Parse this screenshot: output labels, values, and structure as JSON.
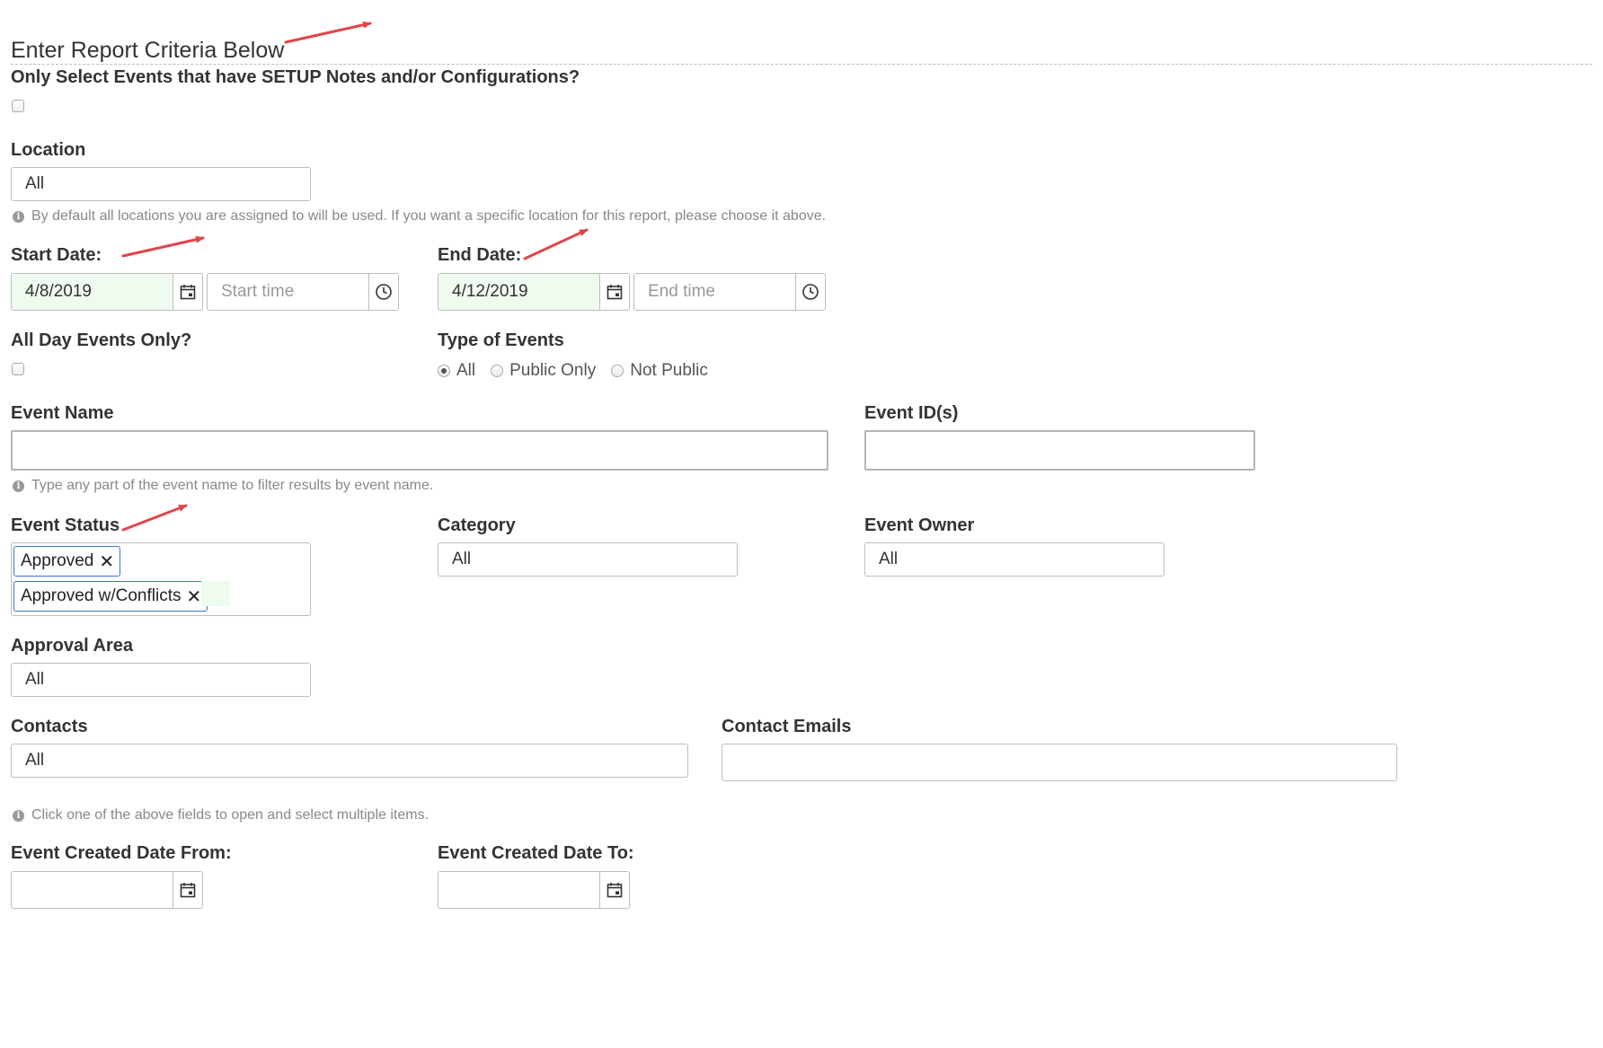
{
  "header": {
    "title": "Enter Report Criteria Below"
  },
  "setup_notes": {
    "label": "Only Select Events that have SETUP Notes and/or Configurations?",
    "checked": false
  },
  "location": {
    "label": "Location",
    "value": "All",
    "help": "By default all locations you are assigned to will be used. If you want a specific location for this report, please choose it above."
  },
  "start": {
    "label": "Start Date:",
    "date": "4/8/2019",
    "time_placeholder": "Start time"
  },
  "end": {
    "label": "End Date:",
    "date": "4/12/2019",
    "time_placeholder": "End time"
  },
  "all_day": {
    "label": "All Day Events Only?",
    "checked": false
  },
  "event_type": {
    "label": "Type of Events",
    "options": [
      {
        "label": "All",
        "selected": true
      },
      {
        "label": "Public Only",
        "selected": false
      },
      {
        "label": "Not Public",
        "selected": false
      }
    ]
  },
  "event_name": {
    "label": "Event Name",
    "value": "",
    "help": "Type any part of the event name to filter results by event name."
  },
  "event_ids": {
    "label": "Event ID(s)",
    "value": ""
  },
  "event_status": {
    "label": "Event Status",
    "tags": [
      "Approved",
      "Approved w/Conflicts"
    ]
  },
  "category": {
    "label": "Category",
    "value": "All"
  },
  "event_owner": {
    "label": "Event Owner",
    "value": "All"
  },
  "approval_area": {
    "label": "Approval Area",
    "value": "All"
  },
  "contacts": {
    "label": "Contacts",
    "value": "All"
  },
  "contact_emails": {
    "label": "Contact Emails",
    "value": ""
  },
  "multi_help": "Click one of the above fields to open and select multiple items.",
  "created_from": {
    "label": "Event Created Date From:",
    "value": ""
  },
  "created_to": {
    "label": "Event Created Date To:",
    "value": ""
  },
  "colors": {
    "annotation_arrow": "#e0454a",
    "tag_border": "#3a78c2",
    "filled_date_bg": "#f0fbef"
  }
}
